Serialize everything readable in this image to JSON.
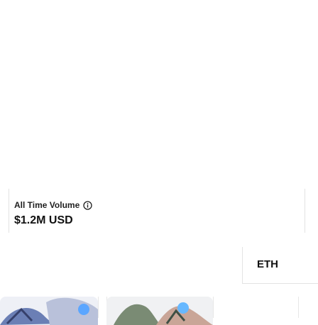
{
  "stats": {
    "volume_label": "All Time Volume",
    "volume_value": "$1.2M USD",
    "info_icon": "info-icon"
  },
  "currency": {
    "label": "ETH"
  },
  "nft_grid": {
    "cards": [
      {
        "name": "nft-card-1",
        "palette": [
          "#5a4a8a",
          "#c7a7e6",
          "#7fd0ff"
        ]
      },
      {
        "name": "nft-card-2",
        "palette": [
          "#4b5d46",
          "#c28a7a",
          "#73c3ff"
        ]
      }
    ]
  },
  "colors": {
    "text": "#111111",
    "divider": "#e3e3e3",
    "accent": "#2f7de1"
  }
}
